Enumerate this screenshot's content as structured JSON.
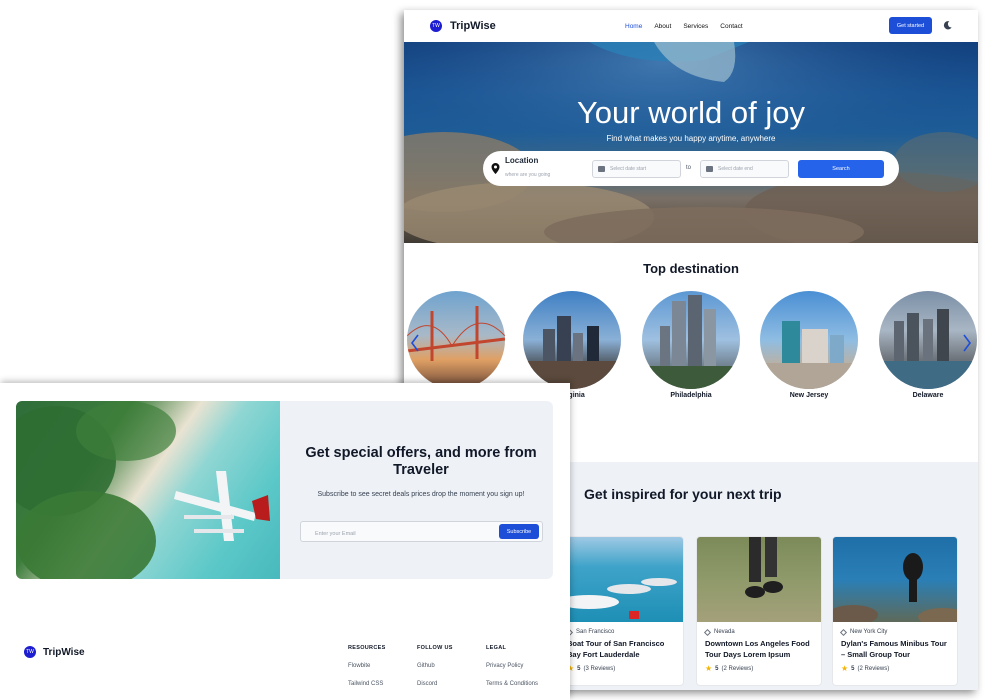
{
  "nav": {
    "logo_text": "TW",
    "brand": "TripWise",
    "links": [
      "Home",
      "About",
      "Services",
      "Contact"
    ],
    "active": "Home",
    "cta": "Get started",
    "theme_icon": "moon-icon"
  },
  "hero": {
    "title": "Your world of joy",
    "subtitle": "Find what makes you happy anytime, anywhere",
    "search": {
      "location_label": "Location",
      "location_placeholder": "where are you going",
      "date_start_placeholder": "Select date start",
      "to_label": "to",
      "date_end_placeholder": "Select date end",
      "button": "Search"
    }
  },
  "top_destination": {
    "title": "Top destination",
    "items": [
      "",
      "Virginia",
      "Philadelphia",
      "New Jersey",
      "Delaware"
    ],
    "prev_icon": "chevron-left-icon",
    "next_icon": "chevron-right-icon"
  },
  "inspired": {
    "title": "Get inspired for your next trip",
    "cards": [
      {
        "location": "San Francisco",
        "title": "Boat Tour of San Francisco Bay Fort Lauderdale",
        "rating": "5",
        "reviews": "(3 Reviews)"
      },
      {
        "location": "Nevada",
        "title": "Downtown Los Angeles Food Tour Days Lorem Ipsum",
        "rating": "5",
        "reviews": "(2 Reviews)"
      },
      {
        "location": "New York City",
        "title": "Dylan's Famous Minibus Tour – Small Group Tour",
        "rating": "5",
        "reviews": "(2 Reviews)"
      }
    ]
  },
  "offer": {
    "title": "Get special offers, and more from Traveler",
    "subtitle": "Subscribe to see secret deals prices drop the moment you sign up!",
    "email_placeholder": "Enter your Email",
    "button": "Subscribe"
  },
  "footer": {
    "brand": "TripWise",
    "logo_text": "TW",
    "columns": [
      {
        "heading": "RESOURCES",
        "links": [
          "Flowbite",
          "Tailwind CSS"
        ]
      },
      {
        "heading": "FOLLOW US",
        "links": [
          "Github",
          "Discord"
        ]
      },
      {
        "heading": "LEGAL",
        "links": [
          "Privacy Policy",
          "Terms & Conditions"
        ]
      }
    ]
  },
  "colors": {
    "accent": "#1d4ed8",
    "brand_dot": "#1d1dd1",
    "star": "#f5b400",
    "section_bg": "#eef2f7"
  }
}
